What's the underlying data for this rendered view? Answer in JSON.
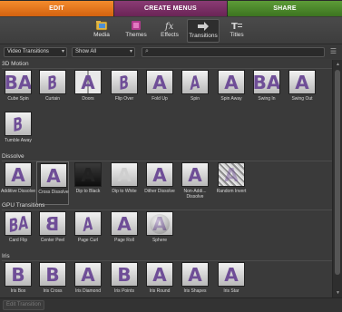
{
  "modes": {
    "edit": "EDIT",
    "create": "CREATE MENUS",
    "share": "SHARE"
  },
  "toolbar": {
    "media": "Media",
    "themes": "Themes",
    "effects": "Effects",
    "transitions": "Transitions",
    "titles": "Titles"
  },
  "filters": {
    "category": "Video Transitions",
    "show": "Show All",
    "search_value": ""
  },
  "sections": {
    "motion": {
      "title": "3D Motion",
      "items": [
        {
          "label": "Cube Spin",
          "glyph": "BA"
        },
        {
          "label": "Curtain",
          "glyph": "B"
        },
        {
          "label": "Doors",
          "glyph": "A"
        },
        {
          "label": "Flip Over",
          "glyph": "B"
        },
        {
          "label": "Fold Up",
          "glyph": "A"
        },
        {
          "label": "Spin",
          "glyph": "A"
        },
        {
          "label": "Spin Away",
          "glyph": "A"
        },
        {
          "label": "Swing In",
          "glyph": "BA"
        },
        {
          "label": "Swing Out",
          "glyph": "A"
        },
        {
          "label": "Tumble Away",
          "glyph": "B"
        }
      ]
    },
    "dissolve": {
      "title": "Dissolve",
      "items": [
        {
          "label": "Additive Dissolve",
          "glyph": "A"
        },
        {
          "label": "Cross Dissolve",
          "glyph": "A"
        },
        {
          "label": "Dip to Black",
          "glyph": "A"
        },
        {
          "label": "Dip to White",
          "glyph": "A"
        },
        {
          "label": "Dither Dissolve",
          "glyph": "A"
        },
        {
          "label": "Non-Addi... Dissolve",
          "glyph": "A"
        },
        {
          "label": "Random Invert",
          "glyph": "A"
        }
      ]
    },
    "gpu": {
      "title": "GPU Transitions",
      "items": [
        {
          "label": "Card Flip",
          "glyph": "BA"
        },
        {
          "label": "Center Peel",
          "glyph": "B"
        },
        {
          "label": "Page Curl",
          "glyph": "A"
        },
        {
          "label": "Page Roll",
          "glyph": "A"
        },
        {
          "label": "Sphere",
          "glyph": "A"
        }
      ]
    },
    "iris": {
      "title": "Iris",
      "items": [
        {
          "label": "Iris Box",
          "glyph": "B"
        },
        {
          "label": "Iris Cross",
          "glyph": "B"
        },
        {
          "label": "Iris Diamond",
          "glyph": "A"
        },
        {
          "label": "Iris Points",
          "glyph": "B"
        },
        {
          "label": "Iris Round",
          "glyph": "A"
        },
        {
          "label": "Iris Shapes",
          "glyph": "A"
        },
        {
          "label": "Iris Star",
          "glyph": "A"
        }
      ]
    }
  },
  "footer": {
    "edit_transition": "Edit Transition"
  },
  "colors": {
    "edit_tab": "#e8761f",
    "create_tab": "#7a2f66",
    "share_tab": "#4c8a2c"
  }
}
